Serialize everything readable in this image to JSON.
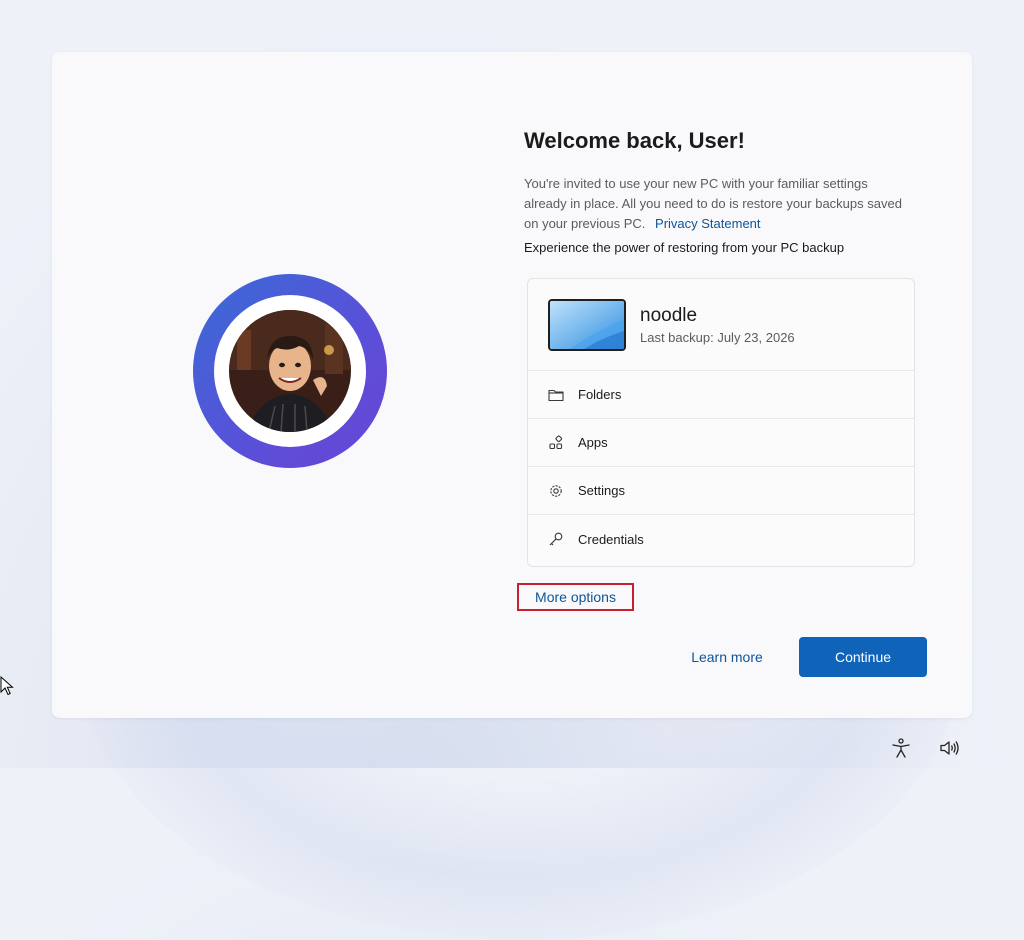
{
  "welcome": {
    "title": "Welcome back, User!",
    "description": "You're invited to use your new PC with your familiar settings already in place. All you need to do is restore your backups saved on your previous PC.",
    "privacy_link": "Privacy Statement",
    "subheading": "Experience the power of restoring from your PC backup"
  },
  "backup": {
    "device_name": "noodle",
    "last_backup": "Last backup: July 23, 2026",
    "items": [
      {
        "label": "Folders",
        "icon": "folder-icon"
      },
      {
        "label": "Apps",
        "icon": "apps-icon"
      },
      {
        "label": "Settings",
        "icon": "gear-icon"
      },
      {
        "label": "Credentials",
        "icon": "key-icon"
      }
    ]
  },
  "actions": {
    "more_options": "More options",
    "learn_more": "Learn more",
    "continue": "Continue"
  },
  "system_tray": {
    "icons": [
      "accessibility-icon",
      "volume-icon"
    ]
  },
  "colors": {
    "accent": "#0f63b8",
    "link": "#0f5499",
    "highlight_box": "#c8202f",
    "avatar_ring_start": "#3a6bd6",
    "avatar_ring_end": "#6b44d4"
  }
}
